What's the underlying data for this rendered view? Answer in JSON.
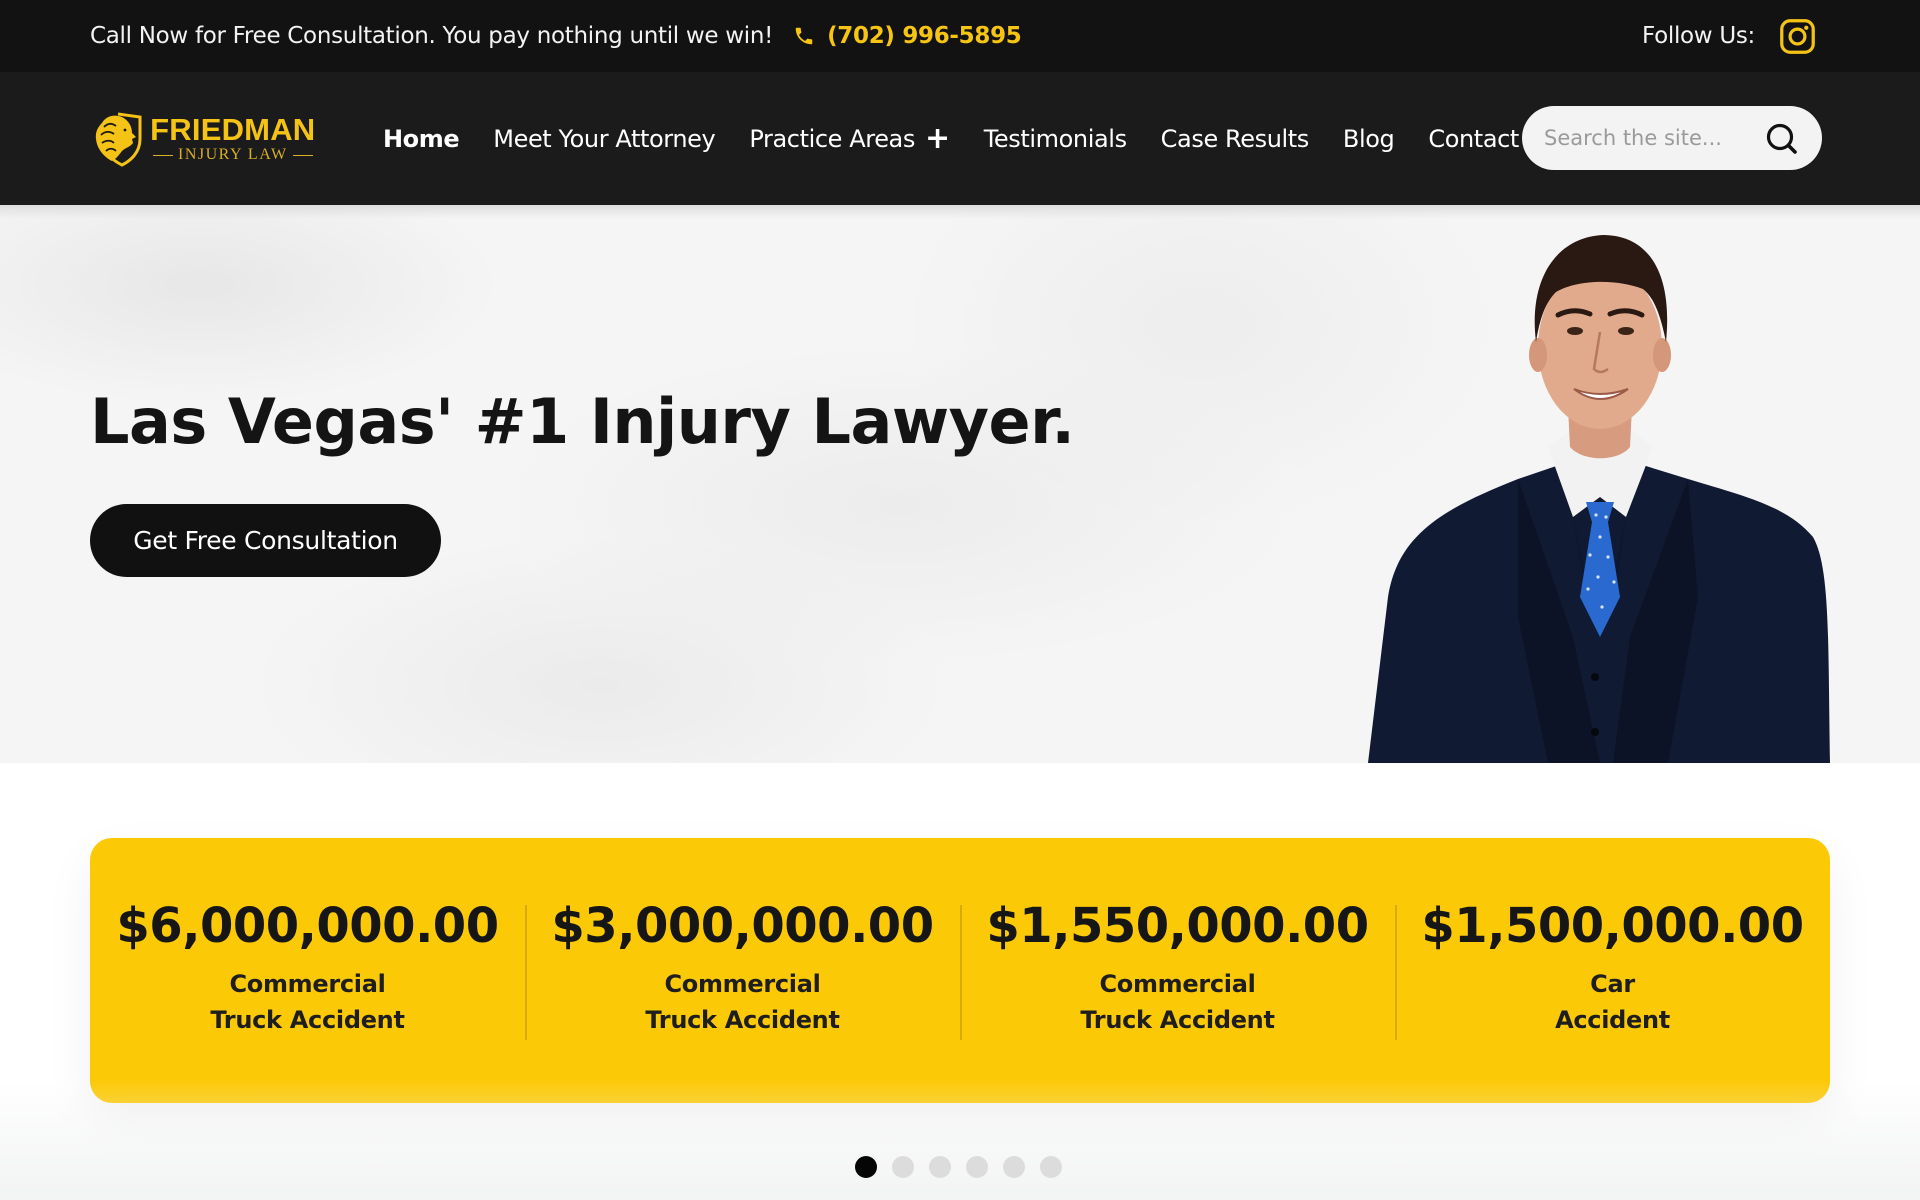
{
  "topbar": {
    "callout": "Call Now for Free Consultation. You pay nothing until we win!",
    "phone": "(702) 996-5895",
    "follow_label": "Follow Us:",
    "social_icon": "instagram-icon"
  },
  "brand": {
    "name": "FRIEDMAN",
    "tagline": "INJURY LAW",
    "accent_color": "#f4c316"
  },
  "nav": {
    "items": [
      {
        "label": "Home",
        "active": true
      },
      {
        "label": "Meet Your Attorney"
      },
      {
        "label": "Practice Areas",
        "has_submenu": true
      },
      {
        "label": "Testimonials"
      },
      {
        "label": "Case Results"
      },
      {
        "label": "Blog"
      },
      {
        "label": "Contact"
      }
    ],
    "search": {
      "placeholder": "Search the site...",
      "value": "",
      "icon": "search-icon"
    }
  },
  "hero": {
    "headline": "Las Vegas' #1 Injury Lawyer.",
    "cta_label": "Get Free Consultation",
    "image": "attorney-portrait"
  },
  "results": {
    "card_color": "#fcc907",
    "items": [
      {
        "amount": "$6,000,000.00",
        "line1": "Commercial",
        "line2": "Truck Accident"
      },
      {
        "amount": "$3,000,000.00",
        "line1": "Commercial",
        "line2": "Truck Accident"
      },
      {
        "amount": "$1,550,000.00",
        "line1": "Commercial",
        "line2": "Truck Accident"
      },
      {
        "amount": "$1,500,000.00",
        "line1": "Car",
        "line2": "Accident"
      }
    ]
  },
  "carousel": {
    "total_pages": 6,
    "active_page": 1
  }
}
